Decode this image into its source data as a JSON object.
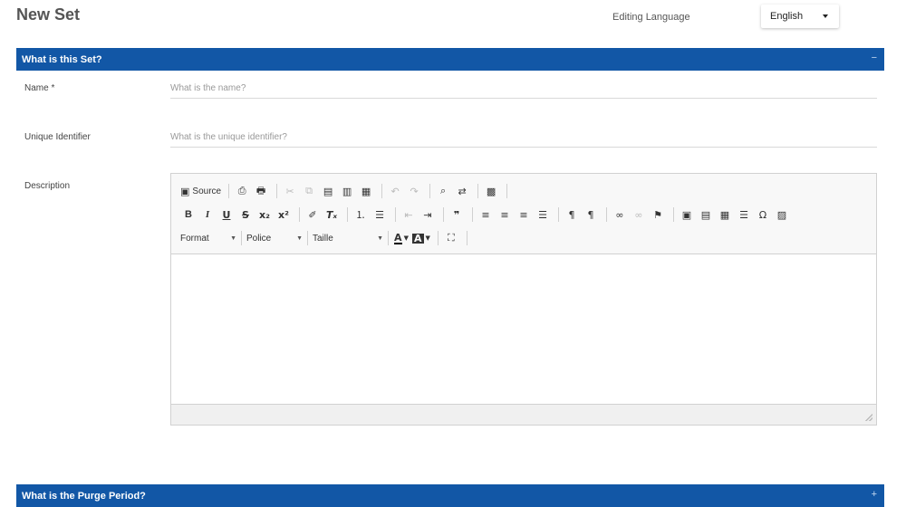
{
  "header": {
    "title": "New Set",
    "editing_language_label": "Editing Language",
    "language_value": "English"
  },
  "section_set": {
    "title": "What is this Set?",
    "toggle": "−"
  },
  "fields": {
    "name_label": "Name *",
    "name_placeholder": "What is the name?",
    "identifier_label": "Unique Identifier",
    "identifier_placeholder": "What is the unique identifier?",
    "description_label": "Description"
  },
  "editor": {
    "source_label": "Source",
    "format_label": "Format",
    "font_label": "Police",
    "size_label": "Taille",
    "text_color_label": "A",
    "bg_color_label": "A"
  },
  "section_purge": {
    "title": "What is the Purge Period?",
    "toggle": "+"
  },
  "colors": {
    "section_bar": "#1257a6"
  }
}
